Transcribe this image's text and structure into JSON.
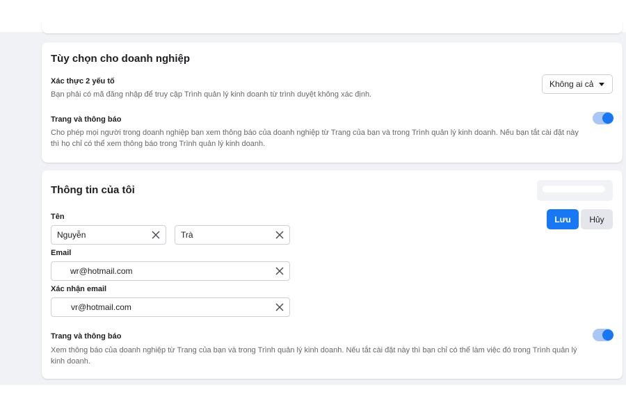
{
  "business_options": {
    "title": "Tùy chọn cho doanh nghiệp",
    "two_factor": {
      "title": "Xác thực 2 yếu tố",
      "description": "Bạn phải có mã đăng nhập để truy cập Trình quản lý kinh doanh từ trình duyệt không xác định.",
      "selected": "Không ai cả"
    },
    "pages_notifications": {
      "title": "Trang và thông báo",
      "description": "Cho phép mọi người trong doanh nghiệp bạn xem thông báo của doanh nghiệp từ Trang của bạn và trong Trình quản lý kinh doanh. Nếu bạn tắt cài đặt này thì họ chỉ có thể xem thông báo trong Trình quản lý kinh doanh.",
      "enabled": true
    }
  },
  "my_info": {
    "title": "Thông tin của tôi",
    "save_label": "Lưu",
    "cancel_label": "Hủy",
    "name_label": "Tên",
    "first_name": "Nguyễn",
    "last_name": "Trà",
    "email_label": "Email",
    "email": "wr@hotmail.com",
    "confirm_email_label": "Xác nhận email",
    "confirm_email": "vr@hotmail.com",
    "pages_notifications": {
      "title": "Trang và thông báo",
      "description": "Xem thông báo của doanh nghiệp từ Trang của bạn và trong Trình quản lý kinh doanh. Nếu tắt cài đặt này thì bạn chỉ có thể làm việc đó trong Trình quản lý kinh doanh.",
      "enabled": true
    }
  },
  "colors": {
    "accent": "#1877f2",
    "background": "#f0f2f5",
    "secondary_text": "#65676b"
  }
}
